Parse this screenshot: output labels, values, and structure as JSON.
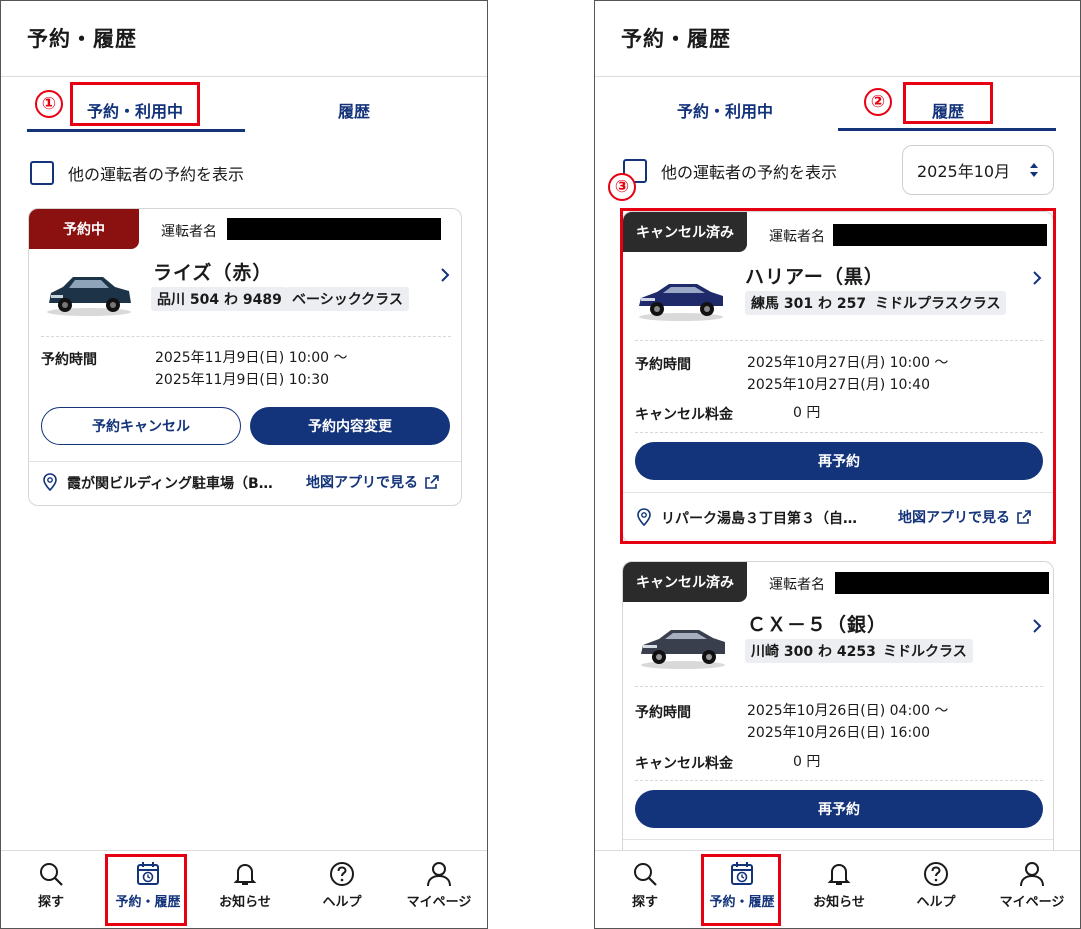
{
  "app": {
    "title": "予約・履歴"
  },
  "tabs": {
    "reserved": "予約・利用中",
    "history": "履歴"
  },
  "steps": {
    "one": "①",
    "two": "②",
    "three": "③"
  },
  "filter": {
    "other_drivers": "他の運転者の予約を表示"
  },
  "month_select": {
    "value": "2025年10月"
  },
  "labels": {
    "driver_name": "運転者名",
    "reservation_time": "予約時間",
    "cancel_fee": "キャンセル料金",
    "map_link": "地図アプリで見る"
  },
  "colors": {
    "primary": "#13337a",
    "reserved_badge": "#8b1010",
    "cancelled_badge": "#2b2b2b",
    "highlight": "#e60012"
  },
  "left_card": {
    "status": "予約中",
    "car_name": "ライズ（赤）",
    "plate": "品川 504 わ 9489",
    "class": "ベーシッククラス",
    "time_start": "2025年11月9日(日) 10:00 ～",
    "time_end": "2025年11月9日(日) 10:30",
    "cancel_button": "予約キャンセル",
    "change_button": "予約内容変更",
    "location": "霞が関ビルディング駐車場（B…"
  },
  "history_cards": [
    {
      "status": "キャンセル済み",
      "car_name": "ハリアー（黒）",
      "plate": "練馬 301 わ 257",
      "class": "ミドルプラスクラス",
      "time_start": "2025年10月27日(月) 10:00 ～",
      "time_end": "2025年10月27日(月) 10:40",
      "cancel_fee": "0 円",
      "rebook_button": "再予約",
      "location": "リパーク湯島３丁目第３（自…"
    },
    {
      "status": "キャンセル済み",
      "car_name": "ＣＸ－５（銀）",
      "plate": "川崎 300 わ 4253",
      "class": "ミドルクラス",
      "time_start": "2025年10月26日(日) 04:00 ～",
      "time_end": "2025年10月26日(日) 16:00",
      "cancel_fee": "0 円",
      "rebook_button": "再予約"
    }
  ],
  "nav": [
    {
      "label": "探す",
      "icon": "search-icon"
    },
    {
      "label": "予約・履歴",
      "icon": "calendar-clock-icon"
    },
    {
      "label": "お知らせ",
      "icon": "bell-icon"
    },
    {
      "label": "ヘルプ",
      "icon": "help-icon"
    },
    {
      "label": "マイページ",
      "icon": "user-icon"
    }
  ]
}
